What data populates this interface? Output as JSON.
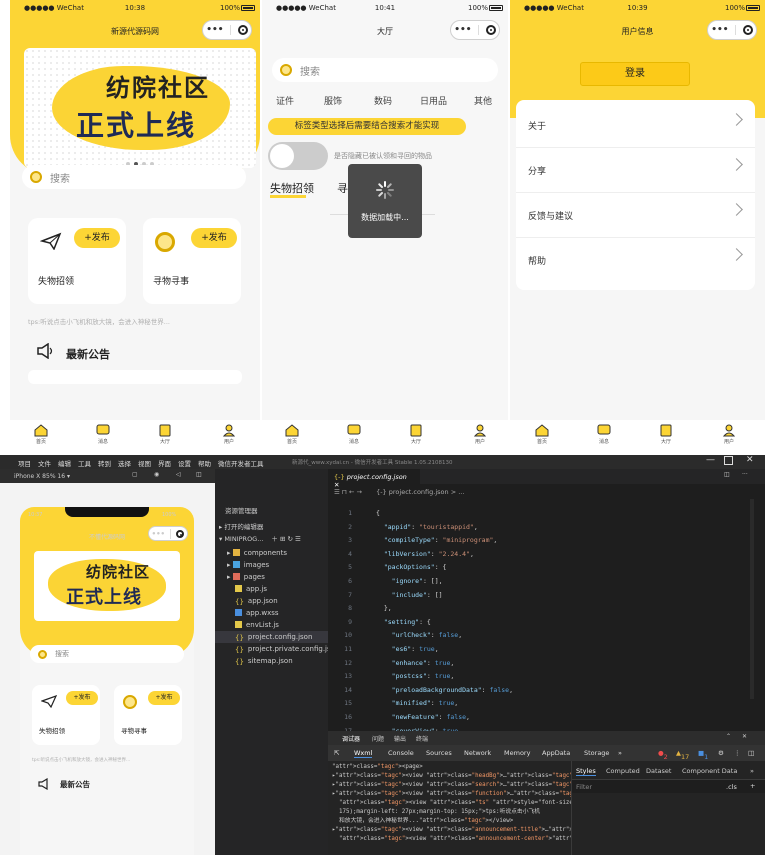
{
  "phone1": {
    "status": {
      "signal": "●●●●● WeChat",
      "time": "10:38",
      "battery": "100%"
    },
    "title": "新源代源码网",
    "banner": {
      "line1": "纺院社区",
      "line2": "正式上线"
    },
    "search_placeholder": "搜索",
    "cards": [
      {
        "label": "失物招领",
        "button": "+发布"
      },
      {
        "label": "寻物寻事",
        "button": "+发布"
      }
    ],
    "tip": "tps:听说点击小飞机和放大镜，会进入神秘世界...",
    "announcement_title": "最新公告"
  },
  "phone2": {
    "status": {
      "signal": "●●●●● WeChat",
      "time": "10:41",
      "battery": "100%"
    },
    "title": "大厅",
    "search_placeholder": "搜索",
    "categories": [
      "证件",
      "服饰",
      "数码",
      "日用品",
      "其他"
    ],
    "notice": "标签类型选择后需要结合搜索才能实现",
    "toggle_label": "是否隐藏已被认领和寻回的物品",
    "tabs": [
      "失物招领",
      "寻"
    ],
    "loading_text": "数据加载中..."
  },
  "phone3": {
    "status": {
      "signal": "●●●●● WeChat",
      "time": "10:39",
      "battery": "100%"
    },
    "title": "用户信息",
    "login_button": "登录",
    "menu": [
      "关于",
      "分享",
      "反馈与建议",
      "帮助"
    ]
  },
  "tabbar": {
    "items": [
      "首页",
      "消息",
      "大厅",
      "用户"
    ]
  },
  "ide": {
    "menu": [
      "项目",
      "文件",
      "编辑",
      "工具",
      "转到",
      "选择",
      "视图",
      "界面",
      "设置",
      "帮助",
      "微信开发者工具"
    ],
    "window_title": "新源代_www.xydai.cn - 微信开发者工具 Stable 1.05.2108130",
    "device": "iPhone X 85% 16 ▾",
    "sim_phone": {
      "time": "10:37",
      "battery": "100%",
      "title": "不懂代源码网",
      "search_placeholder": "搜索",
      "cards": [
        {
          "label": "失物招领",
          "button": "+发布"
        },
        {
          "label": "寻物寻事",
          "button": "+发布"
        }
      ],
      "tip": "tps:听说点击小飞机和放大镜，会进入神秘世界...",
      "announcement_title": "最新公告"
    },
    "explorer": {
      "header": "资源管理器",
      "open_editors": "▸ 打开的编辑器",
      "project": "▾ MINIPROG...",
      "files": [
        "components",
        "images",
        "pages",
        "app.js",
        "app.json",
        "app.wxss",
        "envList.js",
        "project.config.json",
        "project.private.config.js...",
        "sitemap.json"
      ]
    },
    "editor": {
      "tab": "project.config.json",
      "breadcrumb": "{-} project.config.json > ...",
      "lines": [
        [
          "1",
          "{"
        ],
        [
          "2",
          "  \"appid\": \"touristappid\","
        ],
        [
          "3",
          "  \"compileType\": \"miniprogram\","
        ],
        [
          "4",
          "  \"libVersion\": \"2.24.4\","
        ],
        [
          "5",
          "  \"packOptions\": {"
        ],
        [
          "6",
          "    \"ignore\": [],"
        ],
        [
          "7",
          "    \"include\": []"
        ],
        [
          "8",
          "  },"
        ],
        [
          "9",
          "  \"setting\": {"
        ],
        [
          "10",
          "    \"urlCheck\": false,"
        ],
        [
          "11",
          "    \"es6\": true,"
        ],
        [
          "12",
          "    \"enhance\": true,"
        ],
        [
          "13",
          "    \"postcss\": true,"
        ],
        [
          "14",
          "    \"preloadBackgroundData\": false,"
        ],
        [
          "15",
          "    \"minified\": true,"
        ],
        [
          "16",
          "    \"newFeature\": false,"
        ],
        [
          "17",
          "    \"coverView\": true,"
        ]
      ]
    },
    "devtools": {
      "top_tabs": [
        "调试器",
        "问题",
        "输出",
        "终端"
      ],
      "tabs": [
        "Wxml",
        "Console",
        "Sources",
        "Network",
        "Memory",
        "AppData",
        "Storage",
        "»"
      ],
      "counts": {
        "errors": "2",
        "warnings": "17",
        "info": "1"
      },
      "styles_tabs": [
        "Styles",
        "Computed",
        "Dataset",
        "Component Data",
        "»"
      ],
      "filter": "Filter",
      "cls": ".cls",
      "elements": [
        "<page>",
        "▸<view class=\"headBg\">…</view>",
        "▸<view class=\"search\">…</view>",
        "▸<view class=\"function\">…</view>",
        "  <view class=\"ts\" style=\"font-size: 12px;color: rgb(175, 175,",
        "  175);margin-left: 27px;margin-top: 15px;\">tps:听说点击小飞机",
        "  和放大镜，会进入神秘世界...</view>",
        "▸<view class=\"announcement-title\">…</view>",
        "  <view class=\"announcement-center\"></view>"
      ]
    }
  },
  "colors": {
    "brand_yellow": "#fcd535",
    "ide_bg": "#1e1e1e"
  }
}
